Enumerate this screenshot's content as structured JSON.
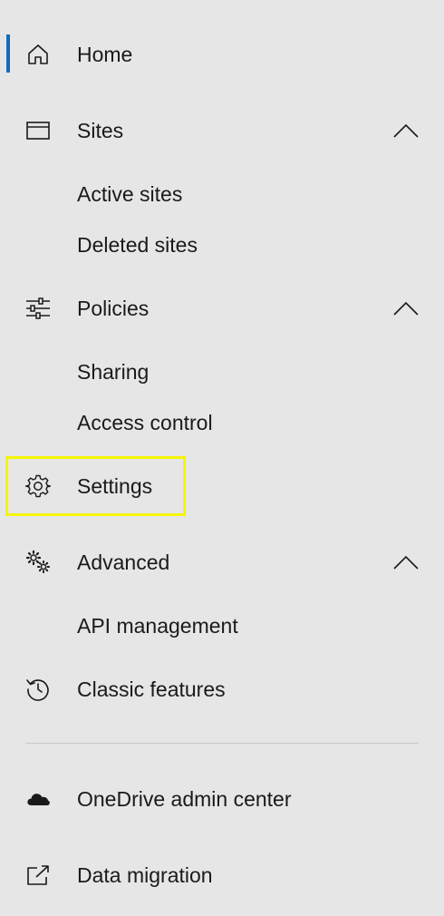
{
  "nav": {
    "home": {
      "label": "Home",
      "icon": "home-icon",
      "active": true
    },
    "sites": {
      "label": "Sites",
      "icon": "browser-window-icon",
      "expanded": true,
      "children": [
        "Active sites",
        "Deleted sites"
      ]
    },
    "policies": {
      "label": "Policies",
      "icon": "sliders-icon",
      "expanded": true,
      "children": [
        "Sharing",
        "Access control"
      ]
    },
    "settings": {
      "label": "Settings",
      "icon": "gear-icon",
      "highlighted": true
    },
    "advanced": {
      "label": "Advanced",
      "icon": "gears-icon",
      "expanded": true,
      "children": [
        "API management"
      ]
    },
    "classic": {
      "label": "Classic features",
      "icon": "history-icon"
    },
    "onedrive": {
      "label": "OneDrive admin center",
      "icon": "cloud-icon"
    },
    "migration": {
      "label": "Data migration",
      "icon": "external-link-icon"
    }
  },
  "colors": {
    "background": "#e6e6e6",
    "active_indicator": "#0f6cbd",
    "highlight_box": "#f5f500",
    "text": "#1a1a1a",
    "divider": "#c8c8c8"
  }
}
